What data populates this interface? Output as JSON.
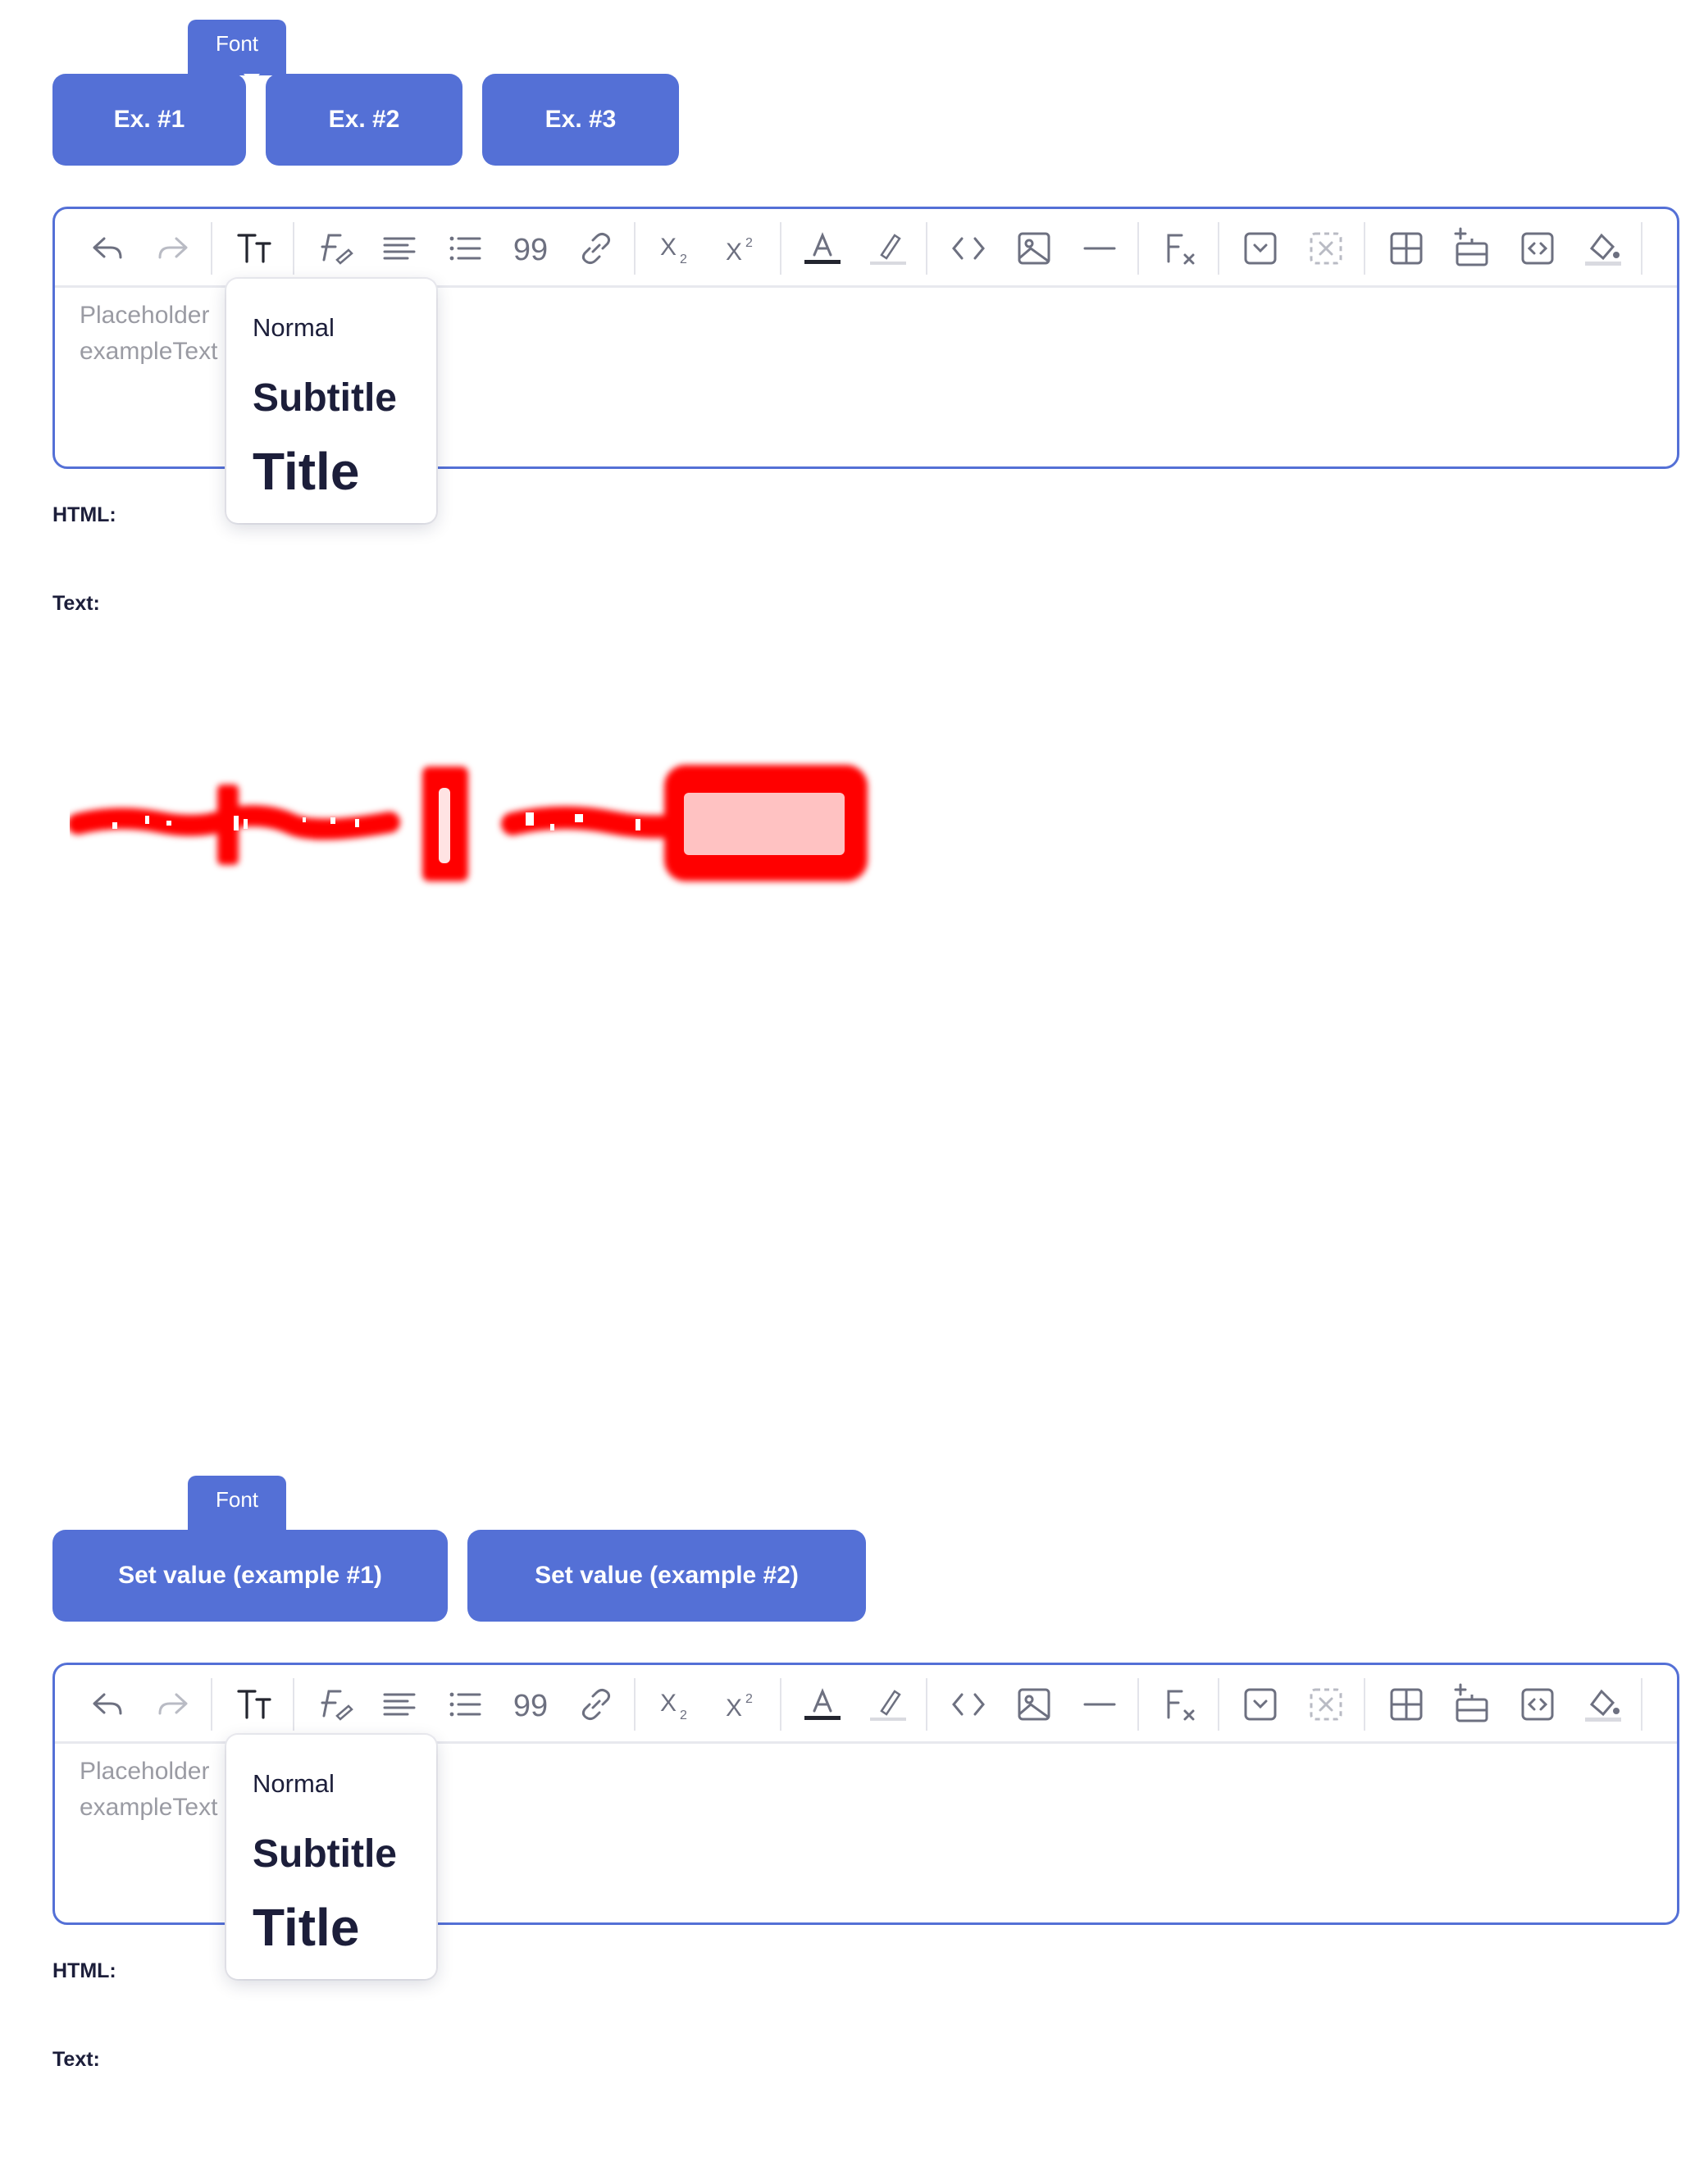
{
  "tooltip": {
    "label": "Font"
  },
  "section_one": {
    "buttons": [
      "Ex. #1",
      "Ex. #2",
      "Ex. #3"
    ]
  },
  "section_two": {
    "buttons": [
      "Set value (example #1)",
      "Set value (example #2)"
    ]
  },
  "editor": {
    "placeholder_line1": "Placeholder",
    "placeholder_line2": "exampleText",
    "accent_color": "#5470d6",
    "toolbar_icons": [
      "undo-icon",
      "redo-icon",
      "font-size-icon",
      "font-style-icon",
      "align-icon",
      "list-icon",
      "blockquote-icon",
      "link-icon",
      "subscript-icon",
      "superscript-icon",
      "text-color-icon",
      "highlight-icon",
      "code-icon",
      "image-icon",
      "horizontal-rule-icon",
      "clear-format-icon",
      "checkbox-icon",
      "placeholder-box-icon",
      "table-icon",
      "insert-row-icon",
      "embed-icon",
      "fill-color-icon"
    ]
  },
  "font_menu": {
    "options": [
      "Normal",
      "Subtitle",
      "Title"
    ]
  },
  "output": {
    "html_label": "HTML:",
    "text_label": "Text:"
  }
}
